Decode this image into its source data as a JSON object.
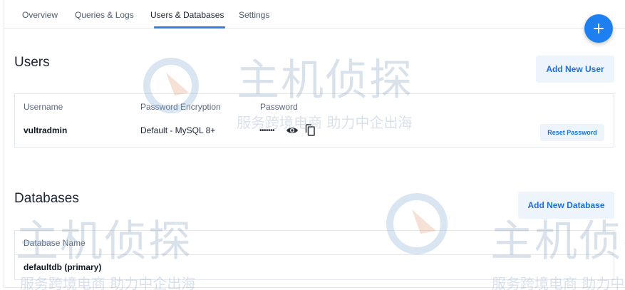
{
  "tabs": [
    {
      "label": "Overview"
    },
    {
      "label": "Queries & Logs"
    },
    {
      "label": "Users & Databases",
      "active": true
    },
    {
      "label": "Settings"
    }
  ],
  "fab_label": "+",
  "users": {
    "title": "Users",
    "add_button": "Add New User",
    "headers": {
      "username": "Username",
      "encryption": "Password Encryption",
      "password": "Password"
    },
    "rows": [
      {
        "username": "vultradmin",
        "encryption": "Default - MySQL 8+",
        "password_masked": "•••••••",
        "reset_label": "Reset Password"
      }
    ]
  },
  "databases": {
    "title": "Databases",
    "add_button": "Add New Database",
    "headers": {
      "name": "Database Name"
    },
    "rows": [
      {
        "name": "defaultdb (primary)"
      }
    ]
  },
  "watermark": {
    "brand": "主机侦探",
    "slogan": "服务跨境电商 助力中企出海"
  },
  "colors": {
    "accent": "#1e80f0",
    "button_bg": "#eef4fc",
    "button_text": "#1e6fd8",
    "tab_underline": "#2f7fe8"
  },
  "icons": [
    "plus-icon",
    "eye-icon",
    "copy-icon"
  ]
}
